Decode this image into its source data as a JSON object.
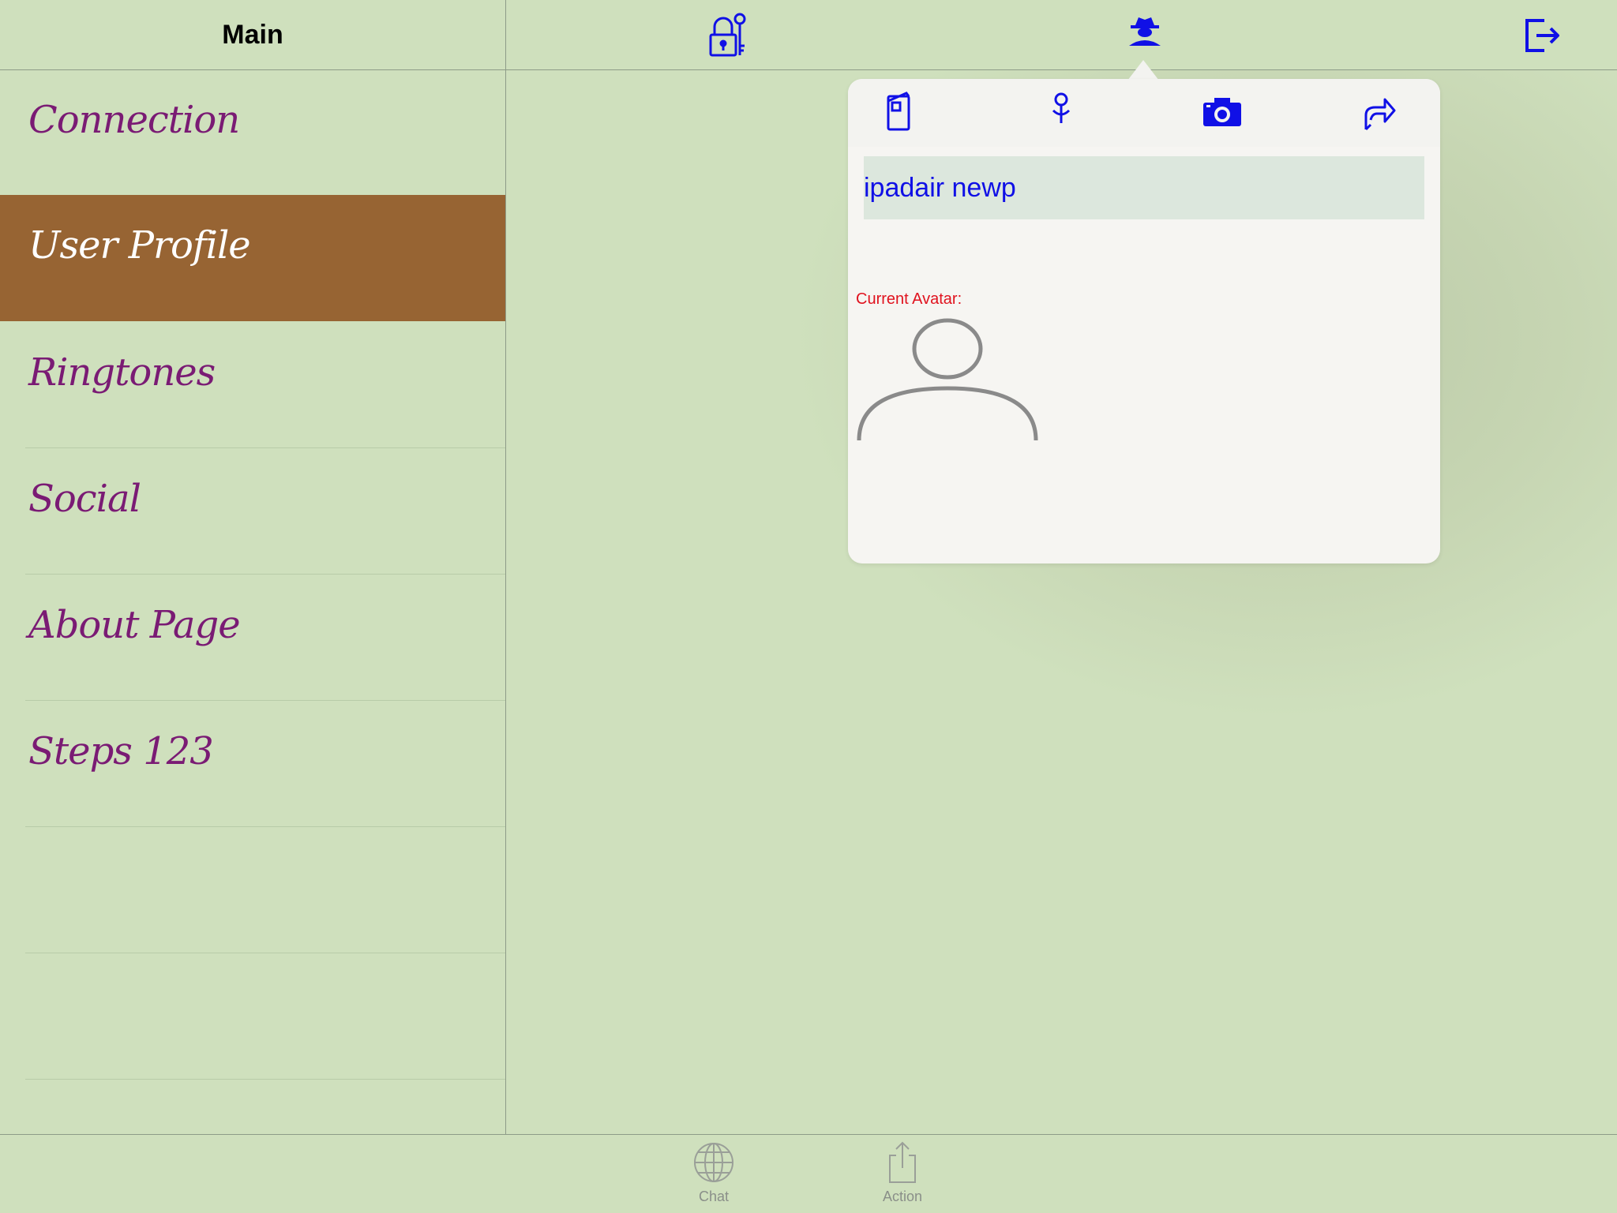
{
  "sidebar": {
    "title": "Main",
    "items": [
      {
        "label": "Connection",
        "selected": false
      },
      {
        "label": "User Profile",
        "selected": true
      },
      {
        "label": "Ringtones",
        "selected": false
      },
      {
        "label": "Social",
        "selected": false
      },
      {
        "label": "About Page",
        "selected": false
      },
      {
        "label": "Steps 123",
        "selected": false
      }
    ]
  },
  "top_bar": {
    "icons": [
      "lock-key-icon",
      "spy-user-icon",
      "logout-icon"
    ]
  },
  "popover": {
    "toolbar_icons": [
      "book-icon",
      "location-pin-icon",
      "camera-icon",
      "share-icon"
    ],
    "name_value": "ipadair newp",
    "avatar_label": "Current Avatar:",
    "avatar_icon": "default-avatar-icon"
  },
  "tab_bar": {
    "tabs": [
      {
        "label": "Chat",
        "icon": "globe-icon"
      },
      {
        "label": "Action",
        "icon": "share-box-icon"
      }
    ]
  },
  "colors": {
    "background": "#cfe0bd",
    "selected_row": "#976433",
    "menu_text": "#7a1b74",
    "icon_blue": "#1010e6",
    "avatar_label": "#e0121e"
  }
}
